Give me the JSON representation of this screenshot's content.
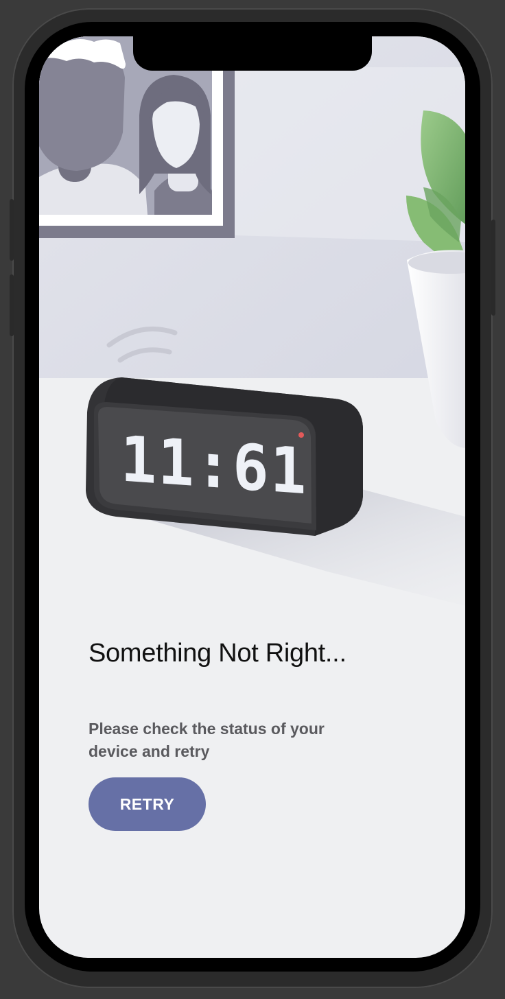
{
  "error_screen": {
    "title": "Something Not Right...",
    "message": "Please check the status of your device and retry",
    "retry_label": "RETRY"
  },
  "illustration": {
    "clock_display": "11:61",
    "accent_color": "#6670a6"
  }
}
